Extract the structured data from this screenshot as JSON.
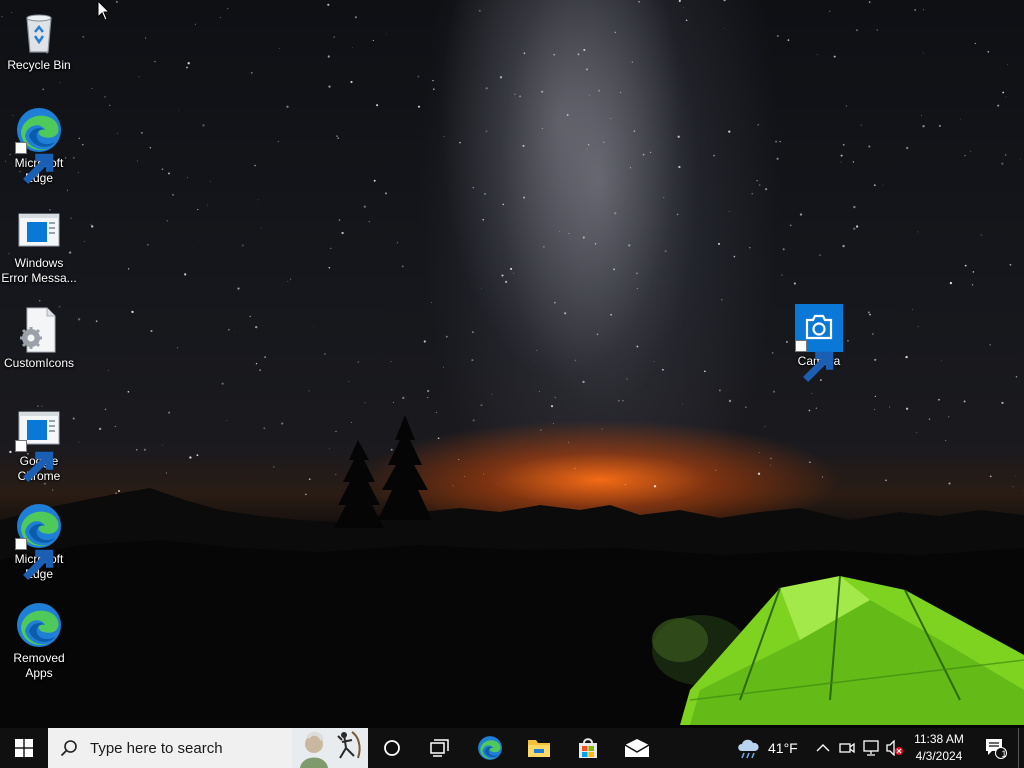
{
  "desktop": {
    "icons": [
      {
        "label": "Recycle Bin",
        "icon": "recycle-bin-icon",
        "shortcut": false
      },
      {
        "label": "Microsoft Edge",
        "icon": "edge-icon",
        "shortcut": true
      },
      {
        "label": "Windows Error Messa...",
        "icon": "window-app-icon",
        "shortcut": false
      },
      {
        "label": "CustomIcons",
        "icon": "settings-file-icon",
        "shortcut": false
      },
      {
        "label": "Google Chrome",
        "icon": "window-app-icon",
        "shortcut": true
      },
      {
        "label": "Microsoft Edge",
        "icon": "edge-icon",
        "shortcut": true
      },
      {
        "label": "Removed Apps",
        "icon": "edge-icon",
        "shortcut": false
      },
      {
        "label": "Camera",
        "icon": "camera-icon",
        "shortcut": true
      }
    ]
  },
  "taskbar": {
    "search_placeholder": "Type here to search",
    "pinned": [
      "cortana-icon",
      "task-view-icon",
      "edge-icon",
      "file-explorer-icon",
      "microsoft-store-icon",
      "mail-icon"
    ],
    "weather": {
      "temp": "41°F",
      "icon": "cloud-rain-icon"
    },
    "clock": {
      "time": "11:38 AM",
      "date": "4/3/2024"
    },
    "notifications": {
      "count": "1"
    }
  },
  "colors": {
    "taskbar_bg": "#101010",
    "edge_blue": "#1f7fd6",
    "edge_green": "#4ec95a",
    "store_red": "#f25022",
    "folder_yellow": "#f3c13a"
  }
}
